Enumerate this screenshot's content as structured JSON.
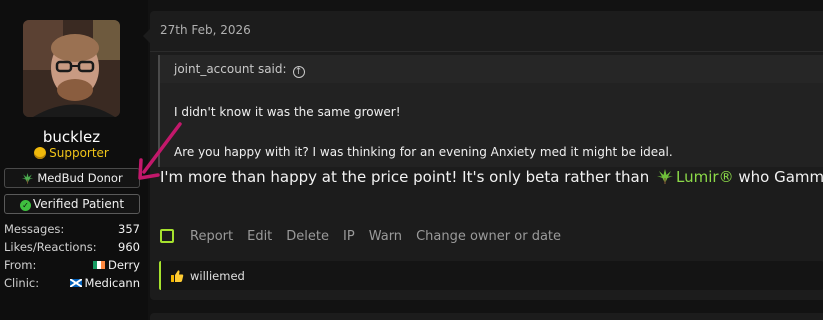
{
  "user": {
    "username": "bucklez",
    "title": "Supporter",
    "banners": {
      "donor": "MedBud Donor",
      "verified": "Verified Patient"
    },
    "stats": [
      {
        "label": "Messages:",
        "value": "357"
      },
      {
        "label": "Likes/Reactions:",
        "value": "960"
      },
      {
        "label": "From:",
        "value": "Derry",
        "flag": "ireland-flag"
      },
      {
        "label": "Clinic:",
        "value": "Medicann",
        "flag": "scotland-flag"
      }
    ]
  },
  "post": {
    "date": "27th Feb, 2026",
    "quote": {
      "author": "joint_account said:",
      "line1": "I didn't know it was the same grower!",
      "line2": "Are you happy with it? I was thinking for an evening Anxiety med it might be ideal."
    },
    "message": {
      "before": "I'm more than happy at the price point! It's only beta rather than",
      "link": "Lumir®",
      "after": "who Gamma it!"
    },
    "actions": [
      "Report",
      "Edit",
      "Delete",
      "IP",
      "Warn",
      "Change owner or date"
    ],
    "reaction_user": "williemed"
  },
  "colors": {
    "accent": "#a6e22e",
    "link": "#8bd948",
    "supporter": "#f0c419",
    "annotation_arrow": "#c2186b"
  },
  "icons": [
    "coin-icon",
    "cannabis-leaf-icon",
    "check-badge-icon",
    "arrow-up-circle-icon",
    "thumbs-up-icon"
  ]
}
